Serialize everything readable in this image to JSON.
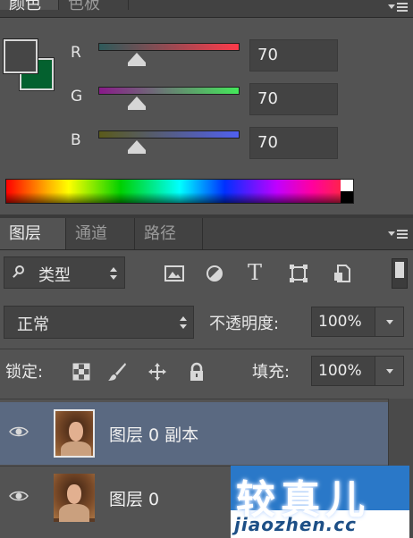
{
  "color_panel": {
    "tabs": [
      {
        "label": "颜色",
        "active": true
      },
      {
        "label": "色板",
        "active": false
      }
    ],
    "foreground_color": "#464646",
    "background_color": "#04612f",
    "channels": [
      {
        "label": "R",
        "value": "70",
        "gradient_start": "#464646",
        "gradient_end": "#ff3a4a"
      },
      {
        "label": "G",
        "value": "70",
        "gradient_start": "#8a1a8a",
        "gradient_end": "#44e85a"
      },
      {
        "label": "B",
        "value": "70",
        "gradient_start": "#5a5a1a",
        "gradient_end": "#5060f0"
      }
    ],
    "menu_icon": "panel-menu-icon"
  },
  "layers_panel": {
    "tabs": [
      {
        "label": "图层",
        "active": true
      },
      {
        "label": "通道",
        "active": false
      },
      {
        "label": "路径",
        "active": false
      }
    ],
    "filter": {
      "label": "类型",
      "icons": [
        "image-filter-icon",
        "adjustment-filter-icon",
        "type-filter-icon",
        "shape-filter-icon",
        "smart-object-filter-icon"
      ],
      "type_icon_glyph": "T"
    },
    "blend_mode": "正常",
    "opacity_label": "不透明度:",
    "opacity_value": "100%",
    "lock_label": "锁定:",
    "lock_icons": [
      "lock-transparent-pixels-icon",
      "lock-image-pixels-icon",
      "lock-position-icon",
      "lock-all-icon"
    ],
    "fill_label": "填充:",
    "fill_value": "100%",
    "layers": [
      {
        "name": "图层 0 副本",
        "visible": true,
        "selected": true
      },
      {
        "name": "图层 0",
        "visible": true,
        "selected": false
      }
    ]
  },
  "watermark": {
    "main_text": "较真儿",
    "sub_text": "jiaozhen.cc"
  }
}
